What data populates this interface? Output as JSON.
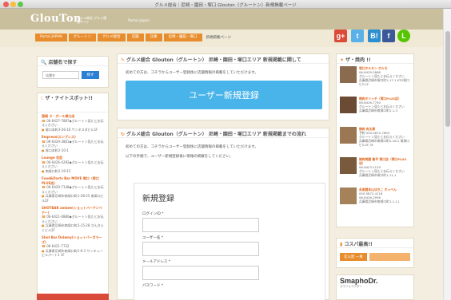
{
  "window": {
    "title": "グルメ総合｜尼崎・園田・塚口 Glouton（グルートン）新規掲載ページ"
  },
  "header": {
    "logo": "GlouTon",
    "tagline": "グルメ総合 グルメ情報サイト",
    "portal": "Portal Japan"
  },
  "breadcrumb": {
    "items": [
      "Portal JAPAN",
      "グルートン",
      "グルメ総合",
      "店舗",
      "兵庫",
      "尼崎・園田・塚口"
    ],
    "current": "新規掲載ページ"
  },
  "social": {
    "google": "g+",
    "twitter": "t",
    "hatena": "B!",
    "facebook": "f",
    "line": "L"
  },
  "left": {
    "search_title": "店舗名で探す",
    "search_placeholder": "店舗名",
    "search_button": "探す",
    "night_title": "ザ・ナイトスポット!!",
    "shops": [
      {
        "name": "酒場 ラ・ガール塚口店",
        "phone": "06-6427-7887",
        "desc": "グルートン見たとお伝えください",
        "addr": "塚口本町3-26-16 サンネスダビル1F"
      },
      {
        "name": "Empress(エンプレス)",
        "phone": "06-6429-3861",
        "desc": "グルートン見たとお伝えください",
        "addr": "塚口本町2-10-1"
      },
      {
        "name": "Lounge 花恋",
        "phone": "06-6426-4292",
        "desc": "グルートン見たとお伝えください",
        "addr": "南塚口町2-19-15"
      },
      {
        "name": "Food&Darts Bar MOVE 塚口（塚口PLUS店）",
        "phone": "06-6429-7148",
        "desc": "グルートン見たとお伝えください",
        "addr": "兵庫県尼崎市南塚口町1-28-25 南塚口ビル2F"
      },
      {
        "name": "SHOTBAR ambee(ショットバーアンベアー)",
        "phone": "06-6421-0880",
        "desc": "グルートン見たとお伝えください",
        "addr": "兵庫県尼崎市南塚口町2-15-28 さんきらくビル2F"
      },
      {
        "name": "Shot Bar Dolemy(ショットバーガラーズ)",
        "phone": "06-6421-7732",
        "desc": "",
        "addr": "兵庫県尼崎市南塚口町1-6-1 サンキュービルパート1 1F"
      }
    ]
  },
  "main": {
    "top_title": "グルメ総合 Glouton（グルートン） 尼崎・園田・塚口エリア 新規掲載に関して",
    "top_intro": "初めての方は、コチラからユーザー登録後に店舗情報の掲載をしていただけます。",
    "register_button": "ユーザー新規登録",
    "form_title_head": "グルメ総合 Glouton（グルートン） 尼崎・園田・塚口エリア 新規掲載までの流れ",
    "form_intro_1": "初めての方は、コチラからユーザー登録後に店舗情報の掲載をしていただけます。",
    "form_intro_2": "以下の手順で、ユーザー新規登録後に情報の掲載をしてください。",
    "form_heading": "新規登録",
    "fields": [
      "ログインID *",
      "ユーザー名 *",
      "メールアドレス *",
      "パスワード *"
    ]
  },
  "right": {
    "yaki_title": "ザ・焼肉 !!",
    "items": [
      {
        "name": "塚口ホルモン ホルモ",
        "phone": "06-6429-2868",
        "desc": "グルートン見たとお伝えください",
        "addr": "兵庫県尼崎市塚口町1-17-1 KTG塚口ビル1F"
      },
      {
        "name": "焼肉ホリッチ（塚口PLUS店）",
        "phone": "06-6426-7750",
        "desc": "グルートン見たとお伝えください",
        "addr": "兵庫県尼崎市南塚口町2-1-3"
      },
      {
        "name": "焼肉 肉太郎",
        "phone": "予約 050-5872-7693",
        "desc": "グルートン見たとお伝えください",
        "addr": "兵庫県尼崎市南塚口町2-16-2 南塚口ビル2F,3F"
      },
      {
        "name": "焼肉問屋 魯平 塚口店（塚口PLUS店）",
        "phone": "06-6423-1129",
        "desc": "グルートン見たとお伝えください",
        "addr": "兵庫県尼崎市塚口町1-11-1"
      },
      {
        "name": "永楽館本山ゆきこ ホッペん",
        "phone": "050-5872-4118",
        "desc": "06-6426-2956",
        "addr": "兵庫県尼崎市南塚口町1-1-11"
      }
    ],
    "cospa_title": "コスパ最高!!",
    "cospa_tag": "炭火屋 一真",
    "smapho_logo": "SmaphoDr.",
    "smapho_sub": "スマフォドクター"
  }
}
